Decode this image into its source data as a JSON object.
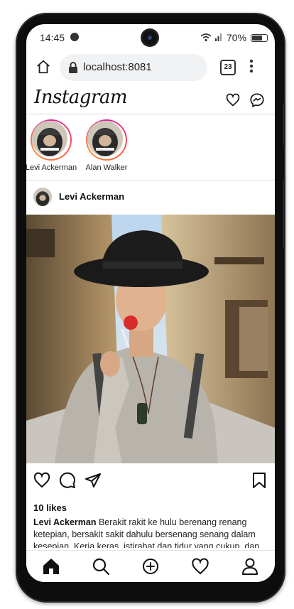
{
  "status_bar": {
    "time": "14:45",
    "battery": "70%"
  },
  "browser": {
    "url": "localhost:8081",
    "tab_count": "23"
  },
  "app": {
    "logo": "Instagram"
  },
  "stories": [
    {
      "name": "Levi Ackerman"
    },
    {
      "name": "Alan Walker"
    }
  ],
  "post": {
    "username": "Levi Ackerman",
    "likes": "10 likes",
    "caption_user": "Levi Ackerman",
    "caption_text": "Berakit rakit ke hulu berenang renang ketepian, bersakit sakit dahulu bersenang senang dalam kesepian. Kerja keras, istirahat dan tidur yang cukup, dan"
  },
  "icons": {
    "status": [
      "spotify-icon",
      "wifi-icon",
      "signal-icon",
      "battery-icon"
    ],
    "browser": [
      "home-icon",
      "lock-icon",
      "tabs-icon",
      "menu-icon"
    ],
    "header": [
      "heart-icon",
      "messenger-icon"
    ],
    "post_actions": [
      "heart-icon",
      "comment-icon",
      "share-icon",
      "bookmark-icon"
    ],
    "nav": [
      "home-icon",
      "search-icon",
      "add-icon",
      "activity-icon",
      "profile-icon"
    ]
  }
}
